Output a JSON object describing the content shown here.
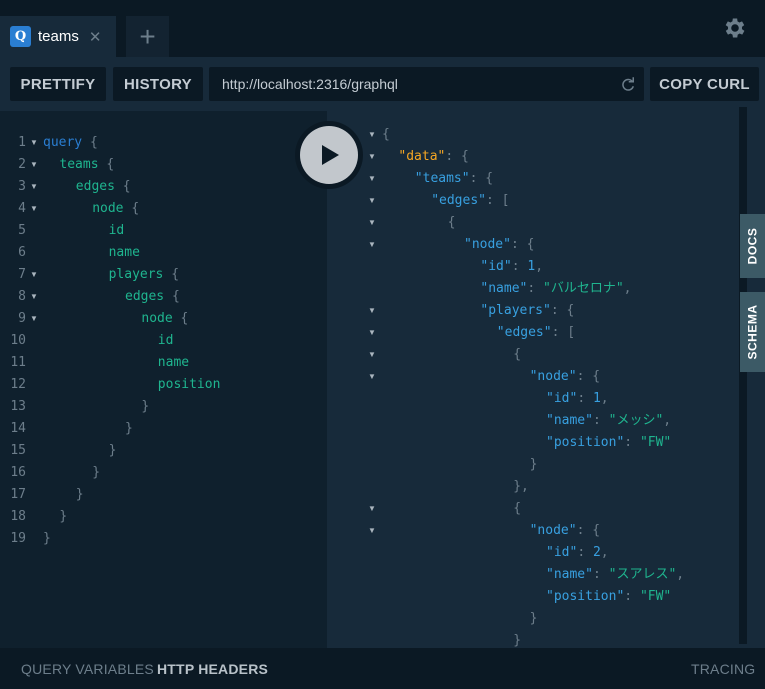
{
  "tabs": [
    {
      "icon": "Q",
      "title": "teams"
    }
  ],
  "tab_add_label": "+",
  "toolbar": {
    "prettify": "PRETTIFY",
    "history": "HISTORY",
    "url": "http://localhost:2316/graphql",
    "copy_curl": "COPY CURL"
  },
  "query_lines": [
    {
      "n": "1",
      "fold": true,
      "indent": 0,
      "tokens": [
        [
          "kw",
          "query"
        ],
        [
          "punc",
          " {"
        ]
      ]
    },
    {
      "n": "2",
      "fold": true,
      "indent": 1,
      "tokens": [
        [
          "fld",
          "teams"
        ],
        [
          "punc",
          " {"
        ]
      ]
    },
    {
      "n": "3",
      "fold": true,
      "indent": 2,
      "tokens": [
        [
          "fld",
          "edges"
        ],
        [
          "punc",
          " {"
        ]
      ]
    },
    {
      "n": "4",
      "fold": true,
      "indent": 3,
      "tokens": [
        [
          "fld",
          "node"
        ],
        [
          "punc",
          " {"
        ]
      ]
    },
    {
      "n": "5",
      "fold": false,
      "indent": 4,
      "tokens": [
        [
          "fld",
          "id"
        ]
      ]
    },
    {
      "n": "6",
      "fold": false,
      "indent": 4,
      "tokens": [
        [
          "fld",
          "name"
        ]
      ]
    },
    {
      "n": "7",
      "fold": true,
      "indent": 4,
      "tokens": [
        [
          "fld",
          "players"
        ],
        [
          "punc",
          " {"
        ]
      ]
    },
    {
      "n": "8",
      "fold": true,
      "indent": 5,
      "tokens": [
        [
          "fld",
          "edges"
        ],
        [
          "punc",
          " {"
        ]
      ]
    },
    {
      "n": "9",
      "fold": true,
      "indent": 6,
      "tokens": [
        [
          "fld",
          "node"
        ],
        [
          "punc",
          " {"
        ]
      ]
    },
    {
      "n": "10",
      "fold": false,
      "indent": 7,
      "tokens": [
        [
          "fld",
          "id"
        ]
      ]
    },
    {
      "n": "11",
      "fold": false,
      "indent": 7,
      "tokens": [
        [
          "fld",
          "name"
        ]
      ]
    },
    {
      "n": "12",
      "fold": false,
      "indent": 7,
      "tokens": [
        [
          "fld",
          "position"
        ]
      ]
    },
    {
      "n": "13",
      "fold": false,
      "indent": 6,
      "tokens": [
        [
          "punc",
          "}"
        ]
      ]
    },
    {
      "n": "14",
      "fold": false,
      "indent": 5,
      "tokens": [
        [
          "punc",
          "}"
        ]
      ]
    },
    {
      "n": "15",
      "fold": false,
      "indent": 4,
      "tokens": [
        [
          "punc",
          "}"
        ]
      ]
    },
    {
      "n": "16",
      "fold": false,
      "indent": 3,
      "tokens": [
        [
          "punc",
          "}"
        ]
      ]
    },
    {
      "n": "17",
      "fold": false,
      "indent": 2,
      "tokens": [
        [
          "punc",
          "}"
        ]
      ]
    },
    {
      "n": "18",
      "fold": false,
      "indent": 1,
      "tokens": [
        [
          "punc",
          "}"
        ]
      ]
    },
    {
      "n": "19",
      "fold": false,
      "indent": 0,
      "tokens": [
        [
          "punc",
          "}"
        ]
      ]
    }
  ],
  "result_lines": [
    {
      "fold": true,
      "indent": 0,
      "tokens": [
        [
          "punc",
          "{"
        ]
      ]
    },
    {
      "fold": true,
      "indent": 1,
      "tokens": [
        [
          "data",
          "\"data\""
        ],
        [
          "punc",
          ": {"
        ]
      ]
    },
    {
      "fold": true,
      "indent": 2,
      "tokens": [
        [
          "key",
          "\"teams\""
        ],
        [
          "punc",
          ": {"
        ]
      ]
    },
    {
      "fold": true,
      "indent": 3,
      "tokens": [
        [
          "key",
          "\"edges\""
        ],
        [
          "punc",
          ": ["
        ]
      ]
    },
    {
      "fold": true,
      "indent": 4,
      "tokens": [
        [
          "punc",
          "{"
        ]
      ]
    },
    {
      "fold": true,
      "indent": 5,
      "tokens": [
        [
          "key",
          "\"node\""
        ],
        [
          "punc",
          ": {"
        ]
      ]
    },
    {
      "fold": false,
      "indent": 6,
      "tokens": [
        [
          "key",
          "\"id\""
        ],
        [
          "punc",
          ": "
        ],
        [
          "num",
          "1"
        ],
        [
          "punc",
          ","
        ]
      ]
    },
    {
      "fold": false,
      "indent": 6,
      "tokens": [
        [
          "key",
          "\"name\""
        ],
        [
          "punc",
          ": "
        ],
        [
          "str",
          "\"バルセロナ\""
        ],
        [
          "punc",
          ","
        ]
      ]
    },
    {
      "fold": true,
      "indent": 6,
      "tokens": [
        [
          "key",
          "\"players\""
        ],
        [
          "punc",
          ": {"
        ]
      ]
    },
    {
      "fold": true,
      "indent": 7,
      "tokens": [
        [
          "key",
          "\"edges\""
        ],
        [
          "punc",
          ": ["
        ]
      ]
    },
    {
      "fold": true,
      "indent": 8,
      "tokens": [
        [
          "punc",
          "{"
        ]
      ]
    },
    {
      "fold": true,
      "indent": 9,
      "tokens": [
        [
          "key",
          "\"node\""
        ],
        [
          "punc",
          ": {"
        ]
      ]
    },
    {
      "fold": false,
      "indent": 10,
      "tokens": [
        [
          "key",
          "\"id\""
        ],
        [
          "punc",
          ": "
        ],
        [
          "num",
          "1"
        ],
        [
          "punc",
          ","
        ]
      ]
    },
    {
      "fold": false,
      "indent": 10,
      "tokens": [
        [
          "key",
          "\"name\""
        ],
        [
          "punc",
          ": "
        ],
        [
          "str",
          "\"メッシ\""
        ],
        [
          "punc",
          ","
        ]
      ]
    },
    {
      "fold": false,
      "indent": 10,
      "tokens": [
        [
          "key",
          "\"position\""
        ],
        [
          "punc",
          ": "
        ],
        [
          "str",
          "\"FW\""
        ]
      ]
    },
    {
      "fold": false,
      "indent": 9,
      "tokens": [
        [
          "punc",
          "}"
        ]
      ]
    },
    {
      "fold": false,
      "indent": 8,
      "tokens": [
        [
          "punc",
          "},"
        ]
      ]
    },
    {
      "fold": true,
      "indent": 8,
      "tokens": [
        [
          "punc",
          "{"
        ]
      ]
    },
    {
      "fold": true,
      "indent": 9,
      "tokens": [
        [
          "key",
          "\"node\""
        ],
        [
          "punc",
          ": {"
        ]
      ]
    },
    {
      "fold": false,
      "indent": 10,
      "tokens": [
        [
          "key",
          "\"id\""
        ],
        [
          "punc",
          ": "
        ],
        [
          "num",
          "2"
        ],
        [
          "punc",
          ","
        ]
      ]
    },
    {
      "fold": false,
      "indent": 10,
      "tokens": [
        [
          "key",
          "\"name\""
        ],
        [
          "punc",
          ": "
        ],
        [
          "str",
          "\"スアレス\""
        ],
        [
          "punc",
          ","
        ]
      ]
    },
    {
      "fold": false,
      "indent": 10,
      "tokens": [
        [
          "key",
          "\"position\""
        ],
        [
          "punc",
          ": "
        ],
        [
          "str",
          "\"FW\""
        ]
      ]
    },
    {
      "fold": false,
      "indent": 9,
      "tokens": [
        [
          "punc",
          "}"
        ]
      ]
    },
    {
      "fold": false,
      "indent": 8,
      "tokens": [
        [
          "punc",
          "}"
        ]
      ]
    }
  ],
  "side_tabs": {
    "docs": "DOCS",
    "schema": "SCHEMA"
  },
  "footer": {
    "query_variables": "QUERY VARIABLES",
    "http_headers": "HTTP HEADERS",
    "tracing": "TRACING"
  },
  "colors": {
    "keyword": "#2a7ed2",
    "field": "#1fb58f",
    "data_key": "#f5a623",
    "json_key": "#38a0e0",
    "string": "#1fb58f"
  },
  "icons": {
    "settings": "gear-icon",
    "run": "play-icon",
    "reload": "reload-icon",
    "close": "close-icon"
  }
}
